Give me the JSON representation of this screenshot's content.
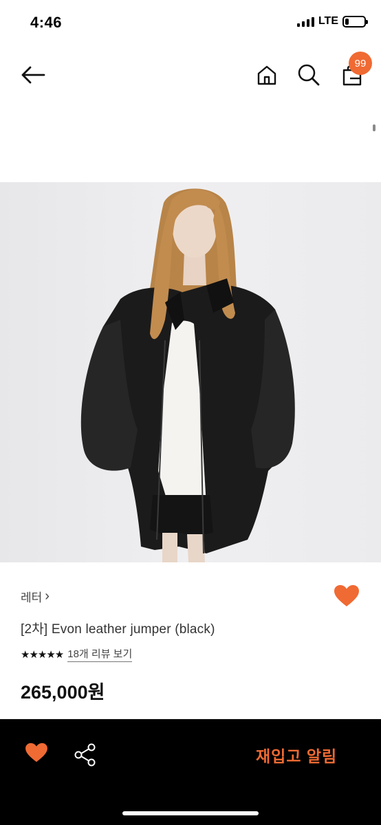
{
  "status": {
    "time": "4:46",
    "network": "LTE",
    "battery_level": 0.2
  },
  "nav": {
    "cart_count": "99"
  },
  "product": {
    "brand": "레터",
    "brand_chevron": "›",
    "name": "[2차] Evon leather jumper (black)",
    "rating_stars": "★★★★★",
    "rating_value": 5,
    "review_link": "18개 리뷰 보기",
    "price": "265,000원",
    "image_pages": 2,
    "image_current_page": 1
  },
  "bottom": {
    "restock_label": "재입고 알림"
  },
  "colors": {
    "accent": "#f06a33",
    "bar_bg": "#000000"
  }
}
